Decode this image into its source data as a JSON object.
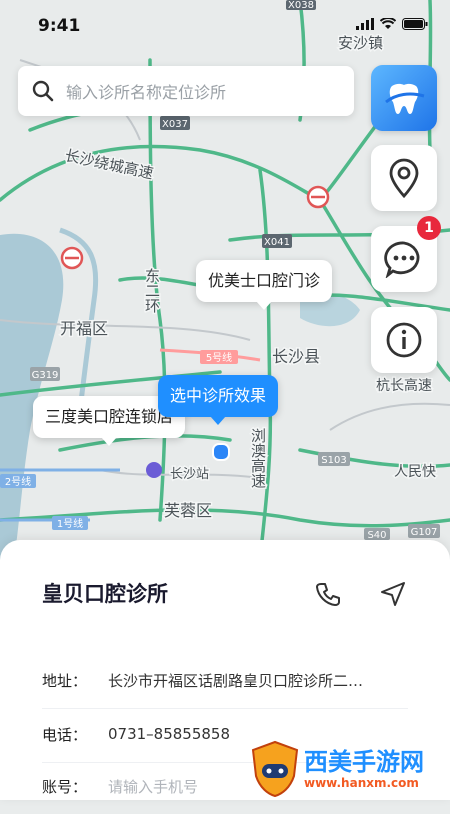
{
  "status_bar": {
    "time": "9:41"
  },
  "search": {
    "placeholder": "输入诊所名称定位诊所"
  },
  "side_buttons": {
    "message_badge": "1"
  },
  "map": {
    "labels": {
      "anshazhen": "安沙镇",
      "x038": "X038",
      "x037": "X037",
      "x041": "X041",
      "ring_highway": "长沙绕城高速",
      "east_second_ring": "东二环",
      "kaifu": "开福区",
      "changsha_county": "长沙县",
      "line5": "5号线",
      "g319": "G319",
      "hangchang": "杭长高速",
      "liuao": "浏澳高速",
      "s103": "S103",
      "renmin": "人民快",
      "changsha_station": "长沙站",
      "furong": "芙蓉区",
      "line2": "2号线",
      "line1": "1号线",
      "g107": "G107",
      "s40": "S40"
    },
    "markers": {
      "youmeishi": "优美士口腔门诊",
      "selected": "选中诊所效果",
      "sandu": "三度美口腔连锁店"
    }
  },
  "clinic": {
    "name": "皇贝口腔诊所",
    "address_label": "地址：",
    "address_value": "长沙市开福区话剧路皇贝口腔诊所二…",
    "phone_label": "电话：",
    "phone_value": "0731–85855858",
    "account_label": "账号：",
    "account_placeholder": "请输入手机号"
  },
  "watermark": {
    "title": "西美手游网",
    "url": "www.hanxm.com"
  }
}
